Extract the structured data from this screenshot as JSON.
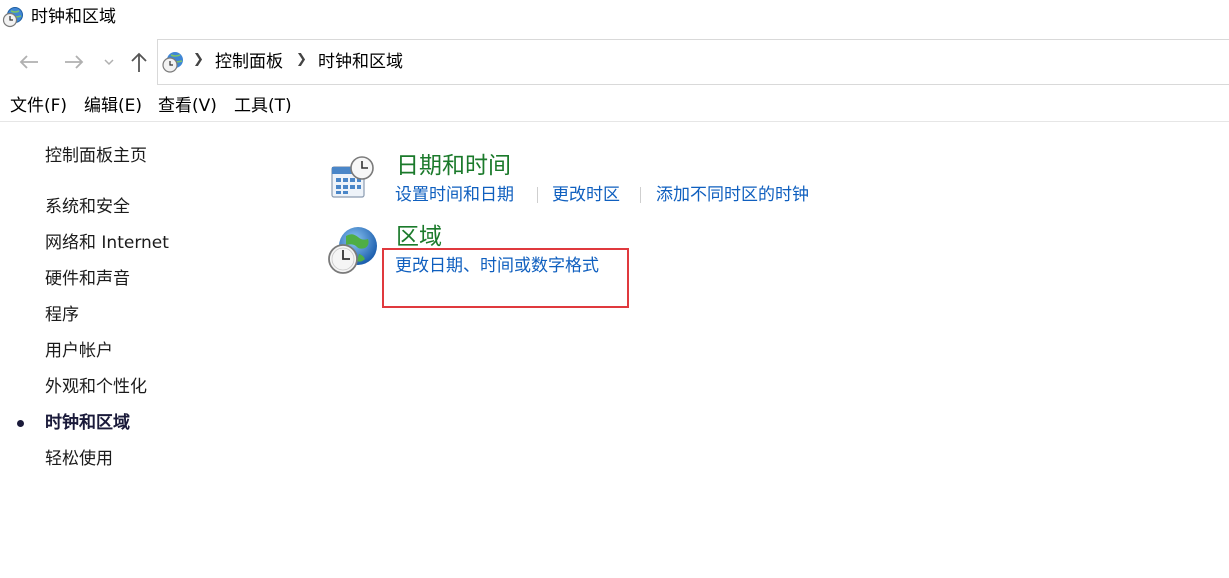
{
  "window": {
    "title": "时钟和区域",
    "icon": "clock-globe-icon"
  },
  "navigation": {
    "back_icon": "back-arrow-icon",
    "forward_icon": "forward-arrow-icon",
    "recent_icon": "chevron-down-icon",
    "up_icon": "up-arrow-icon",
    "breadcrumbs": [
      "控制面板",
      "时钟和区域"
    ]
  },
  "menu": {
    "items": [
      "文件(F)",
      "编辑(E)",
      "查看(V)",
      "工具(T)"
    ]
  },
  "sidebar": {
    "home": "控制面板主页",
    "items": [
      "系统和安全",
      "网络和 Internet",
      "硬件和声音",
      "程序",
      "用户帐户",
      "外观和个性化",
      "时钟和区域",
      "轻松使用"
    ],
    "current": "时钟和区域"
  },
  "main": {
    "categories": [
      {
        "title": "日期和时间",
        "icon": "calendar-clock-icon",
        "links": [
          "设置时间和日期",
          "更改时区",
          "添加不同时区的时钟"
        ]
      },
      {
        "title": "区域",
        "icon": "globe-clock-icon",
        "links": [
          "更改日期、时间或数字格式"
        ]
      }
    ]
  },
  "colors": {
    "category_title": "#1b7a2b",
    "link": "#0f5fbf",
    "highlight_box": "#e0393e"
  }
}
